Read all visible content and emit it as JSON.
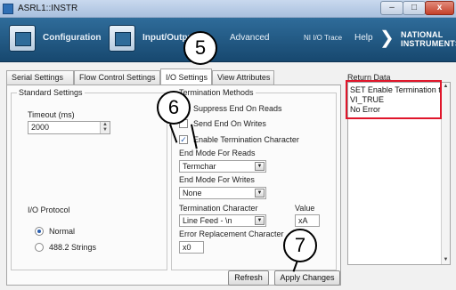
{
  "window": {
    "title": "ASRL1::INSTR",
    "min_glyph": "–",
    "max_glyph": "□",
    "close_glyph": "x"
  },
  "toolbar": {
    "configuration": "Configuration",
    "input_output": "Input/Output",
    "advanced": "Advanced",
    "ni_io_trace": "NI I/O Trace",
    "help": "Help",
    "logo_line1": "NATIONAL",
    "logo_line2": "INSTRUMENTS"
  },
  "tabs": [
    {
      "label": "Serial Settings"
    },
    {
      "label": "Flow Control Settings"
    },
    {
      "label": "I/O Settings"
    },
    {
      "label": "View Attributes"
    }
  ],
  "standard": {
    "legend": "Standard Settings",
    "timeout_label": "Timeout (ms)",
    "timeout_value": "2000",
    "protocol_label": "I/O Protocol",
    "protocol_options": [
      {
        "label": "Normal",
        "selected": true
      },
      {
        "label": "488.2 Strings",
        "selected": false
      }
    ]
  },
  "termination": {
    "legend": "Termination Methods",
    "suppress_end_reads": "Suppress End On Reads",
    "send_end_writes": "Send End On Writes",
    "enable_term_char": "Enable Termination Character",
    "enable_term_char_checked": true,
    "end_mode_reads_label": "End Mode For Reads",
    "end_mode_reads_value": "Termchar",
    "end_mode_writes_label": "End Mode For Writes",
    "end_mode_writes_value": "None",
    "term_char_label": "Termination Character",
    "term_char_value": "Line Feed - \\n",
    "value_label": "Value",
    "value_value": "xA",
    "error_repl_label": "Error Replacement Character",
    "error_repl_value": "x0"
  },
  "buttons": {
    "refresh": "Refresh",
    "apply": "Apply Changes"
  },
  "return_data": {
    "label": "Return Data",
    "lines": [
      "SET Enable Termination to",
      "VI_TRUE",
      "No Error"
    ]
  },
  "callouts": [
    "5",
    "6",
    "7"
  ],
  "colors": {
    "toolbar": "#1f5580",
    "highlight": "#e0162b",
    "radio_selected": "#2a5fb0"
  }
}
